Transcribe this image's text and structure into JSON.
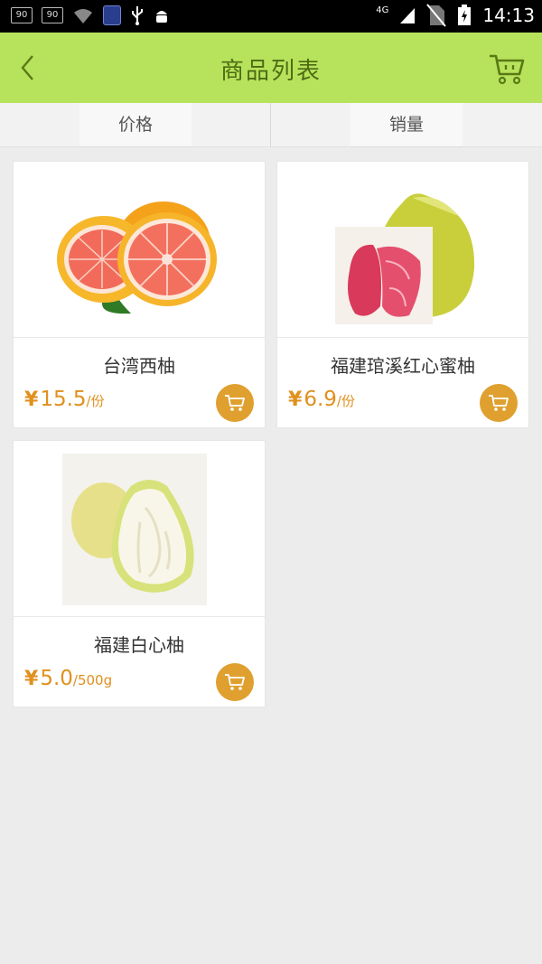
{
  "status_bar": {
    "time": "14:13",
    "left_icons": [
      "notification-90-icon",
      "notification-90-icon",
      "wifi-icon",
      "phone-icon",
      "usb-icon",
      "android-icon"
    ],
    "badge_texts": [
      "90",
      "90"
    ],
    "network": "4G",
    "right_icons": [
      "signal-icon",
      "no-sim-icon",
      "battery-charging-icon"
    ]
  },
  "header": {
    "title": "商品列表",
    "back_icon": "chevron-left-icon",
    "cart_icon": "cart-icon",
    "background_color": "#b7e35c"
  },
  "sort_tabs": [
    {
      "label": "价格"
    },
    {
      "label": "销量"
    }
  ],
  "products": [
    {
      "name": "台湾西柚",
      "currency": "¥",
      "price": "15.5",
      "unit": "/份",
      "image": "grapefruit-image"
    },
    {
      "name": "福建琯溪红心蜜柚",
      "currency": "¥",
      "price": "6.9",
      "unit": "/份",
      "image": "red-pomelo-image"
    },
    {
      "name": "福建白心柚",
      "currency": "¥",
      "price": "5.0",
      "unit": "/500g",
      "image": "white-pomelo-image"
    }
  ],
  "colors": {
    "accent_orange": "#e0a02f",
    "price_color": "#e0901d",
    "header_text": "#4d6b12"
  }
}
